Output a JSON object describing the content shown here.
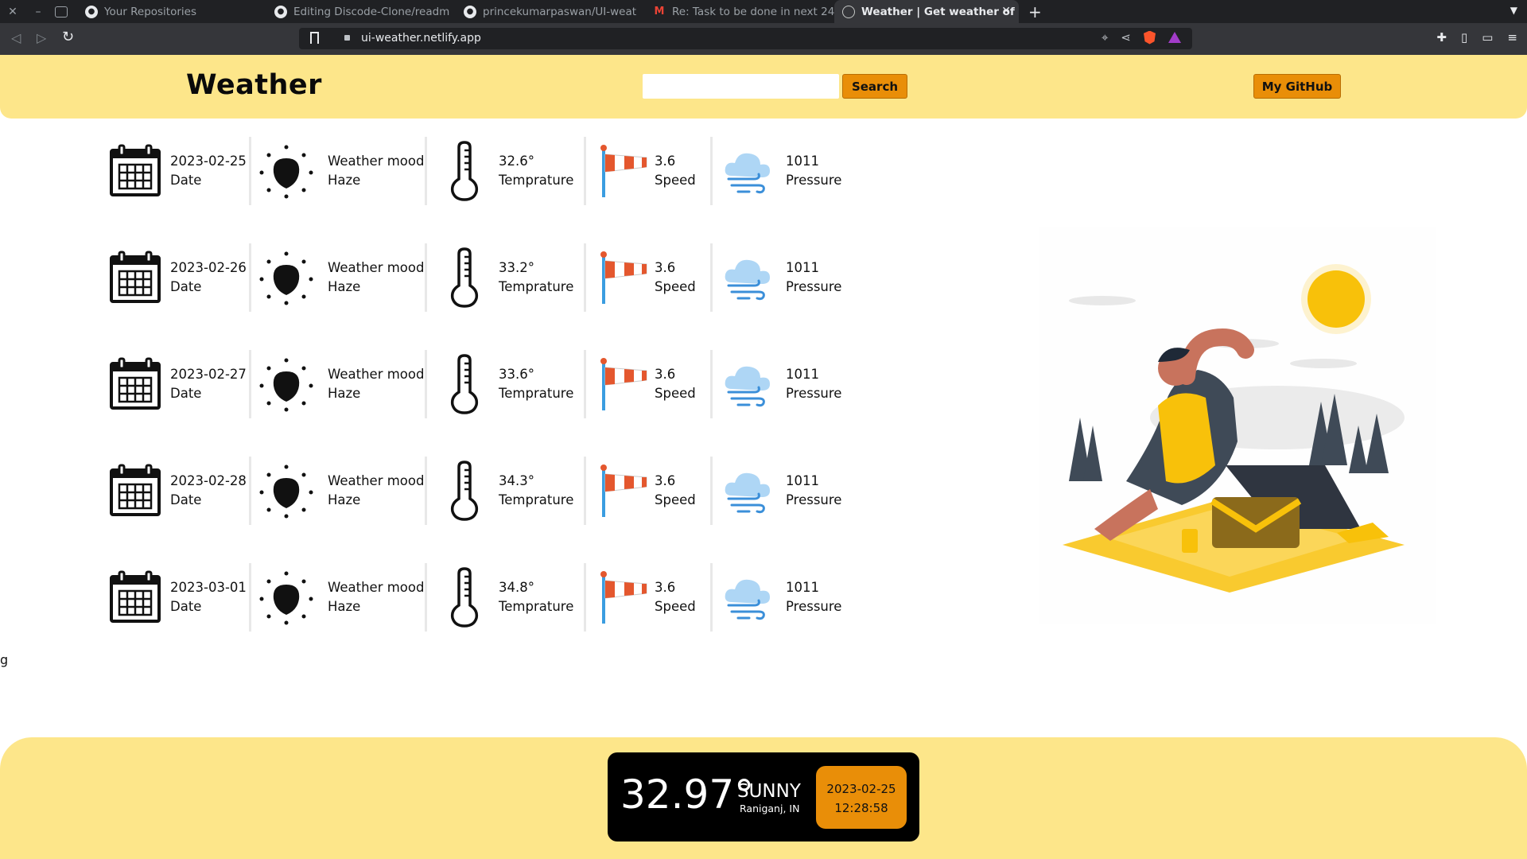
{
  "browser": {
    "tabs": [
      {
        "title": "Your Repositories",
        "icon": "github-icon"
      },
      {
        "title": "Editing Discode-Clone/readm",
        "icon": "github-icon"
      },
      {
        "title": "princekumarpaswan/UI-weat",
        "icon": "github-icon"
      },
      {
        "title": "Re: Task to be done in next 24",
        "icon": "gmail-icon"
      },
      {
        "title": "Weather | Get weather of",
        "icon": "globe-icon",
        "active": true
      }
    ],
    "url": "ui-weather.netlify.app"
  },
  "header": {
    "brand": "Weather",
    "search_placeholder": "",
    "search_label": "Search",
    "github_label": "My GitHub",
    "bg_color": "#fde68a",
    "accent_color": "#e98e08"
  },
  "forecast": [
    {
      "date": "2023-02-25",
      "date_label": "Date",
      "mood_label": "Weather mood",
      "mood": "Haze",
      "temp": "32.6°",
      "temp_label": "Temprature",
      "speed": "3.6",
      "speed_label": "Speed",
      "pressure": "1011",
      "pressure_label": "Pressure"
    },
    {
      "date": "2023-02-26",
      "date_label": "Date",
      "mood_label": "Weather mood",
      "mood": "Haze",
      "temp": "33.2°",
      "temp_label": "Temprature",
      "speed": "3.6",
      "speed_label": "Speed",
      "pressure": "1011",
      "pressure_label": "Pressure"
    },
    {
      "date": "2023-02-27",
      "date_label": "Date",
      "mood_label": "Weather mood",
      "mood": "Haze",
      "temp": "33.6°",
      "temp_label": "Temprature",
      "speed": "3.6",
      "speed_label": "Speed",
      "pressure": "1011",
      "pressure_label": "Pressure"
    },
    {
      "date": "2023-02-28",
      "date_label": "Date",
      "mood_label": "Weather mood",
      "mood": "Haze",
      "temp": "34.3°",
      "temp_label": "Temprature",
      "speed": "3.6",
      "speed_label": "Speed",
      "pressure": "1011",
      "pressure_label": "Pressure"
    },
    {
      "date": "2023-03-01",
      "date_label": "Date",
      "mood_label": "Weather mood",
      "mood": "Haze",
      "temp": "34.8°",
      "temp_label": "Temprature",
      "speed": "3.6",
      "speed_label": "Speed",
      "pressure": "1011",
      "pressure_label": "Pressure"
    }
  ],
  "icons": {
    "date": "calendar-icon",
    "mood": "sun-icon",
    "temp": "thermometer-icon",
    "speed": "windsock-icon",
    "pressure": "wind-cloud-icon"
  },
  "stray_text": "g",
  "current": {
    "temp": "32.97°",
    "condition": "SUNNY",
    "location": "Raniganj, IN",
    "date": "2023-02-25",
    "time": "12:28:58"
  }
}
